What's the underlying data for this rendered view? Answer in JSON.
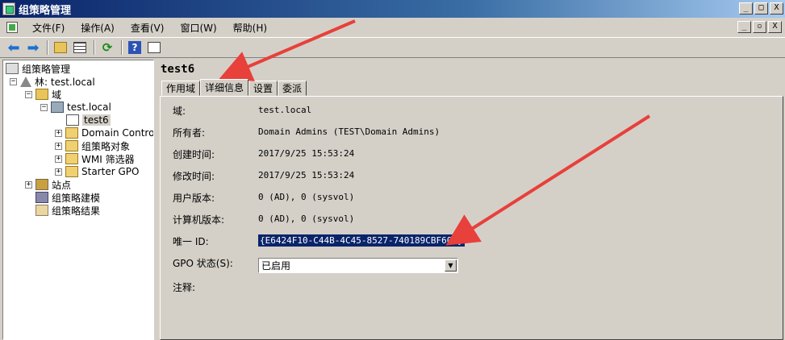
{
  "window": {
    "title": "组策略管理",
    "min": "_",
    "max": "□",
    "close": "X",
    "inner_min": "_",
    "inner_restore": "▫",
    "inner_close": "X"
  },
  "menu": [
    "文件(F)",
    "操作(A)",
    "查看(V)",
    "窗口(W)",
    "帮助(H)"
  ],
  "toolbar": {
    "back": "back-arrow-icon",
    "forward": "forward-arrow-icon",
    "up": "up-folder-icon",
    "show_hide": "console-tree-icon",
    "refresh": "refresh-icon",
    "help": "?",
    "properties": "properties-icon"
  },
  "tree": {
    "root": "组策略管理",
    "forest": "林: test.local",
    "domains": "域",
    "domain": "test.local",
    "gpo": "test6",
    "dc": "Domain Control",
    "gpo_objects": "组策略对象",
    "wmi": "WMI 筛选器",
    "starter": "Starter GPO",
    "sites": "站点",
    "modeling": "组策略建模",
    "results": "组策略结果",
    "expand_minus": "−",
    "expand_plus": "+"
  },
  "details": {
    "gpo_name": "test6",
    "tabs": [
      "作用域",
      "详细信息",
      "设置",
      "委派"
    ],
    "active_tab": 1,
    "fields": {
      "domain_label": "域:",
      "domain_value": "test.local",
      "owner_label": "所有者:",
      "owner_value": "Domain Admins (TEST\\Domain Admins)",
      "created_label": "创建时间:",
      "created_value": "2017/9/25 15:53:24",
      "modified_label": "修改时间:",
      "modified_value": "2017/9/25 15:53:24",
      "user_ver_label": "用户版本:",
      "user_ver_value": "0 (AD), 0 (sysvol)",
      "comp_ver_label": "计算机版本:",
      "comp_ver_value": "0 (AD), 0 (sysvol)",
      "uid_label": "唯一 ID:",
      "uid_value": "{E6424F10-C44B-4C45-8527-740189CBF60E}",
      "status_label": "GPO 状态(S):",
      "status_value": "已启用",
      "comment_label": "注释:"
    }
  },
  "colors": {
    "annotation_arrow": "#e8403a",
    "selection": "#0a246a",
    "titlebar": "#0a246a"
  }
}
